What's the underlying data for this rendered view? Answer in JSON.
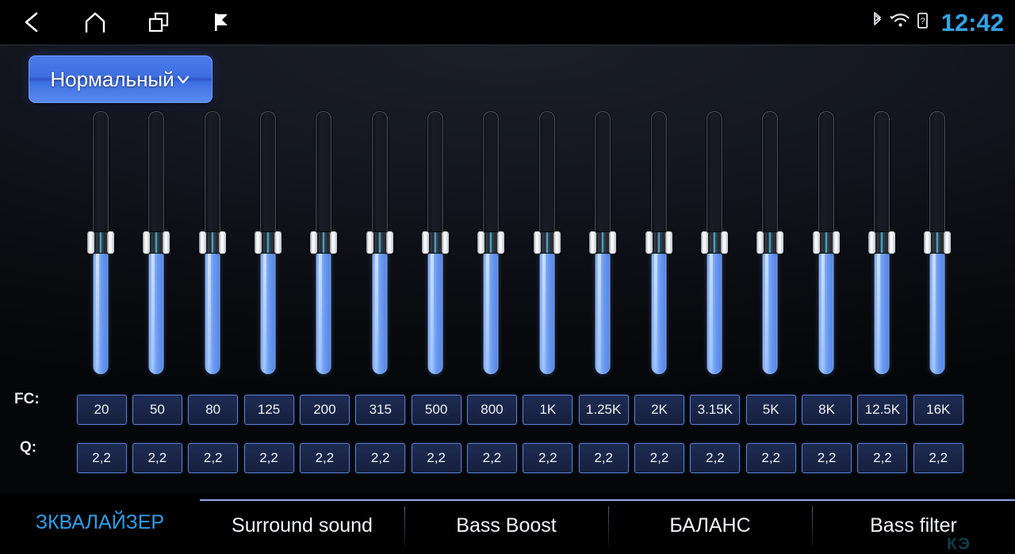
{
  "statusbar": {
    "nav": [
      {
        "name": "back-icon",
        "label": "Back"
      },
      {
        "name": "home-icon",
        "label": "Home"
      },
      {
        "name": "recents-icon",
        "label": "Recent apps"
      },
      {
        "name": "flag-icon",
        "label": "Flag"
      }
    ],
    "system_icons": [
      {
        "name": "bluetooth-icon",
        "label": "Bluetooth"
      },
      {
        "name": "wifi-icon",
        "label": "Wi-Fi"
      },
      {
        "name": "sim-card-icon",
        "label": "SIM"
      }
    ],
    "clock": "12:42",
    "clock_color": "#30a5e8"
  },
  "preset": {
    "label": "Нормальный",
    "icon": "chevron-down-icon",
    "accent": "#3f6fe0"
  },
  "equalizer": {
    "fc_label": "FC:",
    "q_label": "Q:",
    "bands": [
      {
        "fc": "20",
        "q": "2,2",
        "level_pct": 50
      },
      {
        "fc": "50",
        "q": "2,2",
        "level_pct": 50
      },
      {
        "fc": "80",
        "q": "2,2",
        "level_pct": 50
      },
      {
        "fc": "125",
        "q": "2,2",
        "level_pct": 50
      },
      {
        "fc": "200",
        "q": "2,2",
        "level_pct": 50
      },
      {
        "fc": "315",
        "q": "2,2",
        "level_pct": 50
      },
      {
        "fc": "500",
        "q": "2,2",
        "level_pct": 50
      },
      {
        "fc": "800",
        "q": "2,2",
        "level_pct": 50
      },
      {
        "fc": "1K",
        "q": "2,2",
        "level_pct": 50
      },
      {
        "fc": "1.25K",
        "q": "2,2",
        "level_pct": 50
      },
      {
        "fc": "2K",
        "q": "2,2",
        "level_pct": 50
      },
      {
        "fc": "3.15K",
        "q": "2,2",
        "level_pct": 50
      },
      {
        "fc": "5K",
        "q": "2,2",
        "level_pct": 50
      },
      {
        "fc": "8K",
        "q": "2,2",
        "level_pct": 50
      },
      {
        "fc": "12.5K",
        "q": "2,2",
        "level_pct": 50
      },
      {
        "fc": "16K",
        "q": "2,2",
        "level_pct": 50
      }
    ]
  },
  "tabs": [
    {
      "label": "ЗКВАЛАЙЗЕР",
      "active": true
    },
    {
      "label": "Surround sound",
      "active": false
    },
    {
      "label": "Bass Boost",
      "active": false
    },
    {
      "label": "БАЛАНС",
      "active": false
    },
    {
      "label": "Bass filter",
      "active": false
    }
  ],
  "watermark": "КЭ"
}
